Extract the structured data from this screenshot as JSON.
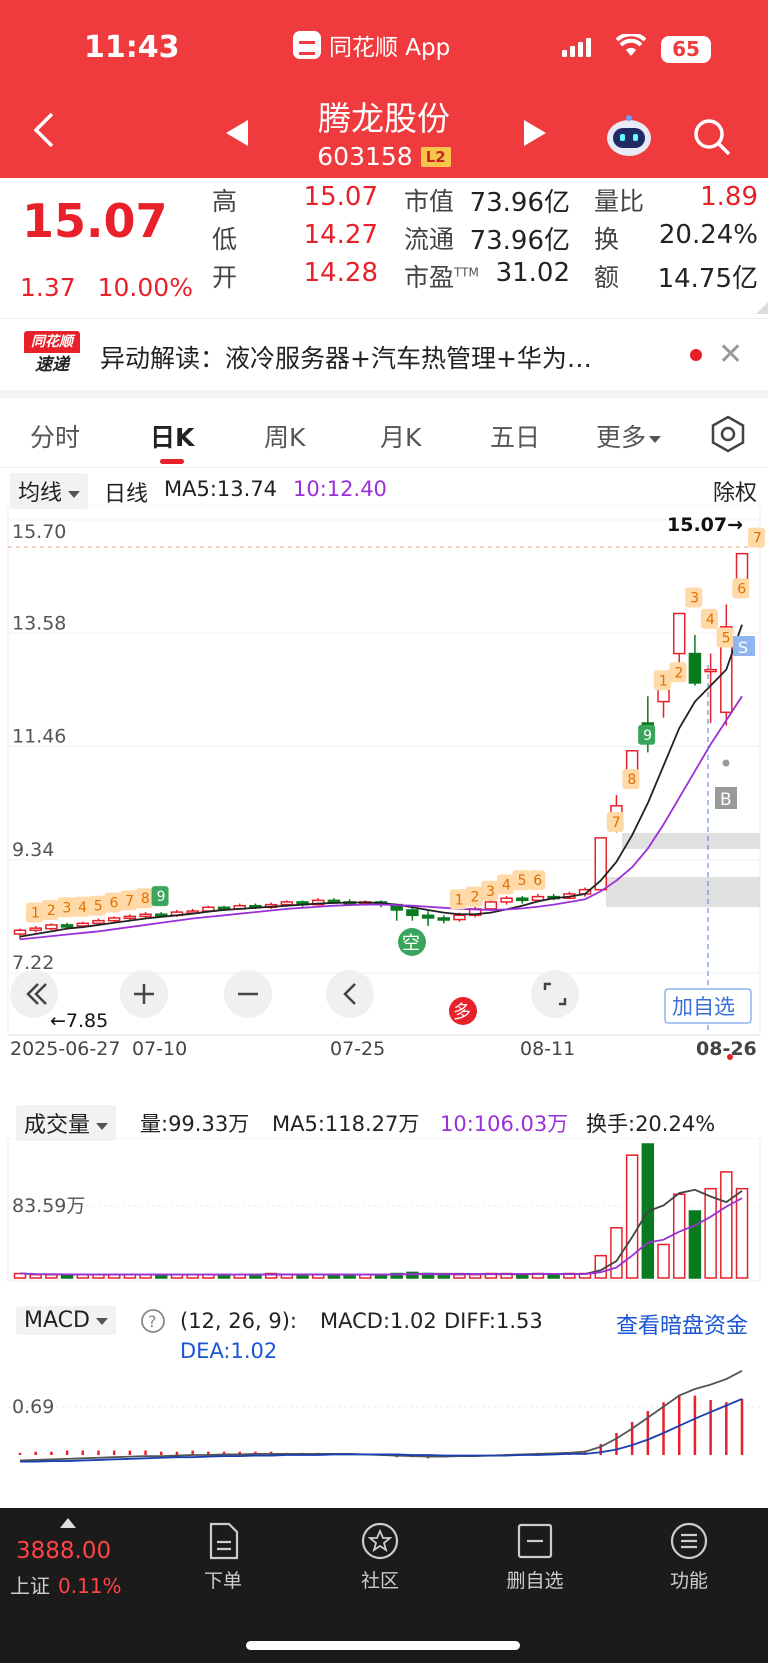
{
  "status": {
    "time": "11:43",
    "app": "同花顺 App",
    "battery": "65"
  },
  "header": {
    "name": "腾龙股份",
    "code": "603158",
    "badge": "L2"
  },
  "quote": {
    "price": "15.07",
    "change": "1.37",
    "pct": "10.00%",
    "high_label": "高",
    "high": "15.07",
    "low_label": "低",
    "low": "14.27",
    "open_label": "开",
    "open": "14.28",
    "mcap_label": "市值",
    "mcap": "73.96亿",
    "float_label": "流通",
    "float": "73.96亿",
    "pe_label": "市盈",
    "pe_ttm": "TTM",
    "pe": "31.02",
    "vr_label": "量比",
    "vr": "1.89",
    "turn_label": "换",
    "turn": "20.24%",
    "amt_label": "额",
    "amt": "14.75亿"
  },
  "news": {
    "logo_top": "同花顺",
    "logo_bot": "速递",
    "text": "异动解读：液冷服务器+汽车热管理+华为…",
    "close": "✕"
  },
  "tabs": [
    "分时",
    "日K",
    "周K",
    "月K",
    "五日",
    "更多"
  ],
  "kline": {
    "ma_chip": "均线",
    "period": "日线",
    "ma5": "MA5:13.74",
    "ma10": "10:12.40",
    "adjust": "除权",
    "y_labels": [
      "15.70",
      "13.58",
      "11.46",
      "9.34",
      "7.22"
    ],
    "last_price_tag": "15.07→",
    "min_tag": "←7.85",
    "dates": [
      "2025-06-27",
      "07-10",
      "07-25",
      "08-11",
      "08-26"
    ],
    "buy_label": "B",
    "sell_label": "S",
    "add_watch": "加自选",
    "empty_mark": "空",
    "long_mark": "多",
    "colors": {
      "up": "#e8202a",
      "down": "#0a7a1f",
      "ma5": "#222222",
      "ma10": "#9b30d9"
    }
  },
  "volume": {
    "chip": "成交量",
    "vol": "量:99.33万",
    "ma5": "MA5:118.27万",
    "ma10": "10:106.03万",
    "turnover": "换手:20.24%",
    "y_label": "83.59万"
  },
  "macd": {
    "chip": "MACD",
    "help": "?",
    "params": "(12, 26, 9):",
    "macd": "MACD:1.02",
    "diff": "DIFF:1.53",
    "dea": "DEA:1.02",
    "link": "查看暗盘资金",
    "y_label": "0.69"
  },
  "bottom": {
    "index_value": "3888.00",
    "index_name": "上证",
    "index_pct": "0.11%",
    "items": [
      "下单",
      "社区",
      "删自选",
      "功能"
    ]
  },
  "chart_data": {
    "type": "candlestick",
    "ylim": [
      7.22,
      15.7
    ],
    "candles": [
      {
        "o": 7.95,
        "c": 8.02,
        "h": 8.05,
        "l": 7.85
      },
      {
        "o": 8.02,
        "c": 8.06,
        "h": 8.1,
        "l": 7.98
      },
      {
        "o": 8.05,
        "c": 8.12,
        "h": 8.15,
        "l": 8.02
      },
      {
        "o": 8.12,
        "c": 8.1,
        "h": 8.16,
        "l": 8.05
      },
      {
        "o": 8.1,
        "c": 8.15,
        "h": 8.18,
        "l": 8.06
      },
      {
        "o": 8.15,
        "c": 8.2,
        "h": 8.24,
        "l": 8.12
      },
      {
        "o": 8.2,
        "c": 8.25,
        "h": 8.28,
        "l": 8.15
      },
      {
        "o": 8.25,
        "c": 8.28,
        "h": 8.32,
        "l": 8.2
      },
      {
        "o": 8.28,
        "c": 8.32,
        "h": 8.36,
        "l": 8.24
      },
      {
        "o": 8.32,
        "c": 8.3,
        "h": 8.36,
        "l": 8.26
      },
      {
        "o": 8.3,
        "c": 8.36,
        "h": 8.4,
        "l": 8.27
      },
      {
        "o": 8.36,
        "c": 8.38,
        "h": 8.42,
        "l": 8.32
      },
      {
        "o": 8.38,
        "c": 8.45,
        "h": 8.48,
        "l": 8.35
      },
      {
        "o": 8.45,
        "c": 8.42,
        "h": 8.48,
        "l": 8.38
      },
      {
        "o": 8.42,
        "c": 8.48,
        "h": 8.52,
        "l": 8.4
      },
      {
        "o": 8.48,
        "c": 8.45,
        "h": 8.52,
        "l": 8.42
      },
      {
        "o": 8.45,
        "c": 8.5,
        "h": 8.54,
        "l": 8.42
      },
      {
        "o": 8.5,
        "c": 8.55,
        "h": 8.58,
        "l": 8.46
      },
      {
        "o": 8.55,
        "c": 8.5,
        "h": 8.58,
        "l": 8.46
      },
      {
        "o": 8.5,
        "c": 8.58,
        "h": 8.62,
        "l": 8.48
      },
      {
        "o": 8.58,
        "c": 8.55,
        "h": 8.62,
        "l": 8.52
      },
      {
        "o": 8.55,
        "c": 8.52,
        "h": 8.6,
        "l": 8.48
      },
      {
        "o": 8.52,
        "c": 8.55,
        "h": 8.58,
        "l": 8.48
      },
      {
        "o": 8.55,
        "c": 8.5,
        "h": 8.58,
        "l": 8.45
      },
      {
        "o": 8.5,
        "c": 8.4,
        "h": 8.52,
        "l": 8.2
      },
      {
        "o": 8.4,
        "c": 8.3,
        "h": 8.45,
        "l": 8.2
      },
      {
        "o": 8.3,
        "c": 8.25,
        "h": 8.38,
        "l": 8.1
      },
      {
        "o": 8.25,
        "c": 8.22,
        "h": 8.3,
        "l": 8.15
      },
      {
        "o": 8.22,
        "c": 8.3,
        "h": 8.35,
        "l": 8.18
      },
      {
        "o": 8.3,
        "c": 8.42,
        "h": 8.46,
        "l": 8.26
      },
      {
        "o": 8.42,
        "c": 8.55,
        "h": 8.58,
        "l": 8.38
      },
      {
        "o": 8.55,
        "c": 8.62,
        "h": 8.66,
        "l": 8.5
      },
      {
        "o": 8.62,
        "c": 8.58,
        "h": 8.66,
        "l": 8.52
      },
      {
        "o": 8.58,
        "c": 8.65,
        "h": 8.7,
        "l": 8.55
      },
      {
        "o": 8.65,
        "c": 8.62,
        "h": 8.7,
        "l": 8.58
      },
      {
        "o": 8.62,
        "c": 8.7,
        "h": 8.74,
        "l": 8.6
      },
      {
        "o": 8.7,
        "c": 8.78,
        "h": 8.82,
        "l": 8.65
      },
      {
        "o": 8.78,
        "c": 9.75,
        "h": 9.75,
        "l": 8.76
      },
      {
        "o": 9.9,
        "c": 10.35,
        "h": 10.55,
        "l": 9.85
      },
      {
        "o": 10.8,
        "c": 11.38,
        "h": 11.38,
        "l": 10.7
      },
      {
        "o": 11.9,
        "c": 11.75,
        "h": 12.4,
        "l": 11.35
      },
      {
        "o": 12.3,
        "c": 12.55,
        "h": 12.55,
        "l": 12.0
      },
      {
        "o": 13.2,
        "c": 13.95,
        "h": 13.95,
        "l": 12.9
      },
      {
        "o": 13.2,
        "c": 12.65,
        "h": 13.55,
        "l": 12.6
      },
      {
        "o": 12.9,
        "c": 12.9,
        "h": 13.2,
        "l": 11.9
      },
      {
        "o": 12.1,
        "c": 13.7,
        "h": 14.12,
        "l": 11.85
      },
      {
        "o": 14.28,
        "c": 15.07,
        "h": 15.07,
        "l": 14.27
      }
    ],
    "ma5": [
      7.9,
      7.95,
      8.0,
      8.05,
      8.08,
      8.12,
      8.16,
      8.2,
      8.24,
      8.27,
      8.3,
      8.33,
      8.37,
      8.4,
      8.42,
      8.44,
      8.46,
      8.48,
      8.5,
      8.52,
      8.53,
      8.54,
      8.54,
      8.53,
      8.5,
      8.45,
      8.4,
      8.35,
      8.32,
      8.32,
      8.35,
      8.41,
      8.48,
      8.56,
      8.62,
      8.65,
      8.7,
      8.95,
      9.3,
      9.8,
      10.4,
      11.1,
      11.8,
      12.3,
      12.6,
      12.9,
      13.74
    ],
    "ma10": [
      7.85,
      7.88,
      7.91,
      7.94,
      7.97,
      8.0,
      8.04,
      8.08,
      8.12,
      8.16,
      8.2,
      8.24,
      8.27,
      8.3,
      8.33,
      8.36,
      8.39,
      8.42,
      8.44,
      8.46,
      8.48,
      8.49,
      8.5,
      8.5,
      8.49,
      8.48,
      8.46,
      8.44,
      8.42,
      8.41,
      8.4,
      8.41,
      8.43,
      8.46,
      8.5,
      8.55,
      8.6,
      8.75,
      8.95,
      9.2,
      9.55,
      10.0,
      10.5,
      11.0,
      11.5,
      11.95,
      12.4
    ],
    "volume": [
      4,
      3,
      3,
      3,
      3,
      3,
      3,
      3,
      3,
      3,
      3,
      3,
      3,
      3,
      3,
      3,
      4,
      3,
      3,
      3,
      3,
      3,
      3,
      3,
      4,
      5,
      4,
      3,
      3,
      3,
      4,
      4,
      3,
      4,
      3,
      4,
      4,
      20,
      45,
      110,
      120,
      30,
      75,
      60,
      80,
      95,
      80
    ],
    "macd_diff": [
      -0.1,
      -0.09,
      -0.08,
      -0.07,
      -0.06,
      -0.05,
      -0.04,
      -0.03,
      -0.02,
      -0.02,
      -0.01,
      0.0,
      0.0,
      0.01,
      0.01,
      0.02,
      0.02,
      0.02,
      0.02,
      0.02,
      0.02,
      0.02,
      0.01,
      0.0,
      -0.01,
      -0.02,
      -0.03,
      -0.03,
      -0.02,
      -0.02,
      -0.01,
      0.0,
      0.01,
      0.02,
      0.03,
      0.04,
      0.06,
      0.15,
      0.3,
      0.48,
      0.68,
      0.88,
      1.08,
      1.2,
      1.28,
      1.38,
      1.53
    ],
    "macd_dea": [
      -0.12,
      -0.12,
      -0.11,
      -0.11,
      -0.1,
      -0.09,
      -0.08,
      -0.07,
      -0.06,
      -0.05,
      -0.04,
      -0.04,
      -0.03,
      -0.02,
      -0.02,
      -0.01,
      -0.01,
      0.0,
      0.0,
      0.0,
      0.01,
      0.01,
      0.01,
      0.01,
      0.01,
      0.0,
      0.0,
      -0.01,
      -0.01,
      -0.01,
      -0.01,
      -0.01,
      0.0,
      0.0,
      0.01,
      0.02,
      0.02,
      0.05,
      0.1,
      0.18,
      0.28,
      0.4,
      0.53,
      0.66,
      0.78,
      0.9,
      1.02
    ],
    "macd_hist": [
      0.04,
      0.06,
      0.06,
      0.08,
      0.08,
      0.08,
      0.08,
      0.08,
      0.08,
      0.06,
      0.06,
      0.08,
      0.06,
      0.06,
      0.06,
      0.06,
      0.06,
      0.04,
      0.04,
      0.04,
      0.02,
      0.02,
      0.0,
      -0.02,
      -0.04,
      -0.04,
      -0.06,
      -0.04,
      -0.02,
      -0.02,
      0.0,
      0.02,
      0.02,
      0.04,
      0.04,
      0.04,
      0.08,
      0.2,
      0.4,
      0.6,
      0.8,
      0.96,
      1.1,
      1.08,
      1.0,
      0.96,
      1.02
    ]
  }
}
